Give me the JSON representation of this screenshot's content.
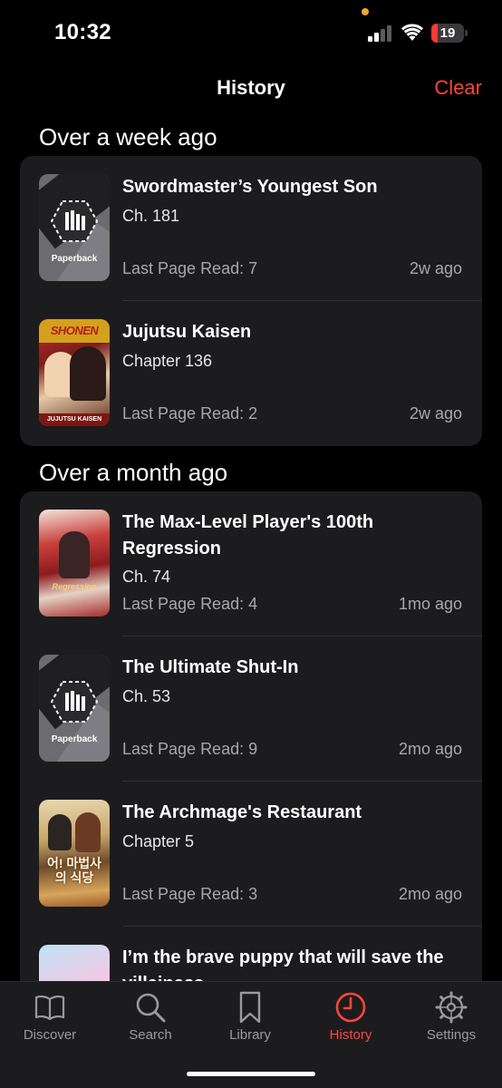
{
  "status_bar": {
    "time": "10:32",
    "battery_level": "19",
    "battery_fraction": 0.19,
    "battery_color": "#ff3b30",
    "signal_bars_active": 2,
    "icons": [
      "signal-icon",
      "wifi-icon",
      "battery-icon"
    ]
  },
  "nav": {
    "title": "History",
    "clear_label": "Clear",
    "accent_color": "#ff453a"
  },
  "sections": [
    {
      "header": "Over a week ago",
      "items": [
        {
          "title": "Swordmaster’s Youngest Son",
          "chapter": "Ch. 181",
          "last_read": "Last Page Read: 7",
          "ago": "2w ago",
          "cover": "paperback-placeholder",
          "placeholder_label": "Paperback"
        },
        {
          "title": "Jujutsu Kaisen",
          "chapter": "Chapter 136",
          "last_read": "Last Page Read: 2",
          "ago": "2w ago",
          "cover": "jujutsu-kaisen-cover",
          "cover_top": "SHONEN",
          "cover_bottom": "JUJUTSU KAISEN"
        }
      ]
    },
    {
      "header": "Over a month ago",
      "items": [
        {
          "title": "The Max-Level Player's 100th Regression",
          "chapter": "Ch. 74",
          "last_read": "Last Page Read: 4",
          "ago": "1mo ago",
          "cover": "max-level-player-cover",
          "cover_text": "Regression"
        },
        {
          "title": "The Ultimate Shut-In",
          "chapter": "Ch. 53",
          "last_read": "Last Page Read: 9",
          "ago": "2mo ago",
          "cover": "paperback-placeholder",
          "placeholder_label": "Paperback"
        },
        {
          "title": "The Archmage's Restaurant",
          "chapter": "Chapter 5",
          "last_read": "Last Page Read: 3",
          "ago": "2mo ago",
          "cover": "archmage-restaurant-cover",
          "cover_text": "어! 마법사의 식당"
        },
        {
          "title": "I’m the brave puppy that will save the villainess",
          "chapter": "",
          "last_read": "",
          "ago": "",
          "cover": "brave-puppy-cover"
        }
      ]
    }
  ],
  "tabbar": {
    "tabs": [
      {
        "label": "Discover",
        "icon": "book-open-icon",
        "active": false
      },
      {
        "label": "Search",
        "icon": "search-icon",
        "active": false
      },
      {
        "label": "Library",
        "icon": "bookmark-icon",
        "active": false
      },
      {
        "label": "History",
        "icon": "clock-icon",
        "active": true
      },
      {
        "label": "Settings",
        "icon": "gear-icon",
        "active": false
      }
    ],
    "inactive_color": "#9a9a9e",
    "active_color": "#ff453a"
  }
}
